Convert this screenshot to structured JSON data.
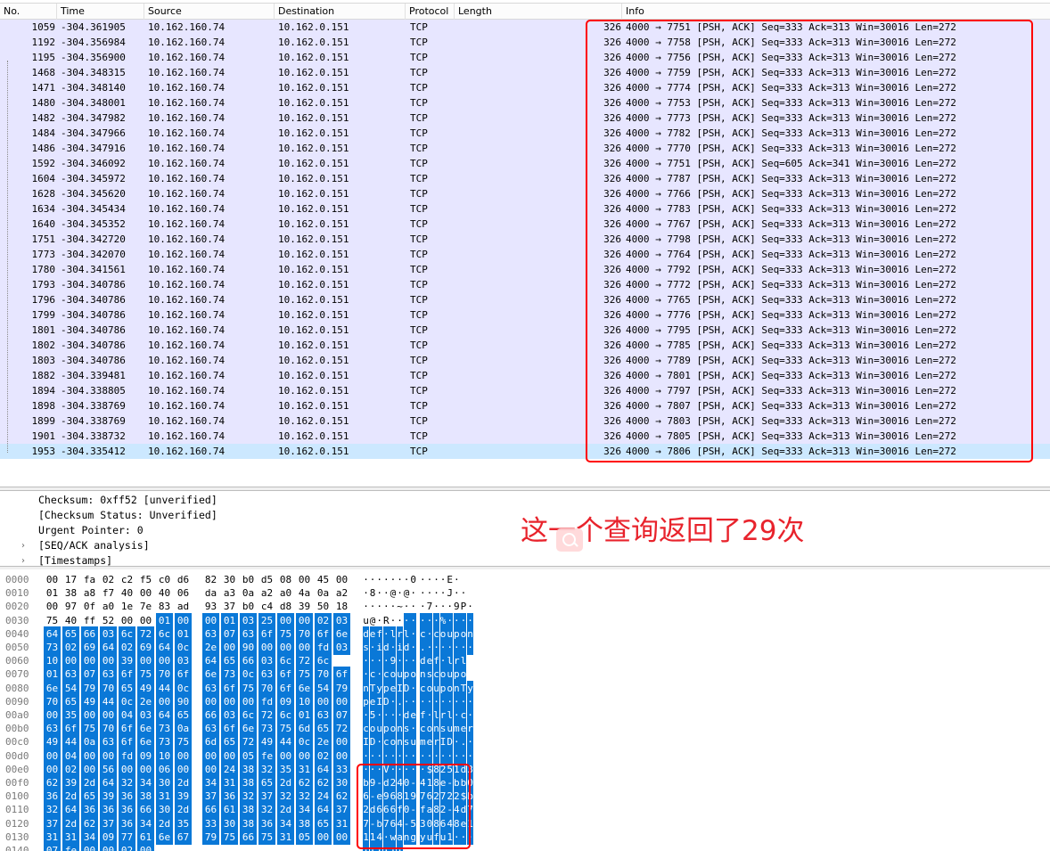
{
  "columns": {
    "no": "No.",
    "time": "Time",
    "source": "Source",
    "destination": "Destination",
    "protocol": "Protocol",
    "length": "Length",
    "info": "Info"
  },
  "packets": [
    {
      "no": "1059",
      "time": "-304.361905",
      "src": "10.162.160.74",
      "dst": "10.162.0.151",
      "proto": "TCP",
      "len": "326",
      "info": "4000 → 7751 [PSH, ACK] Seq=333 Ack=313 Win=30016 Len=272"
    },
    {
      "no": "1192",
      "time": "-304.356984",
      "src": "10.162.160.74",
      "dst": "10.162.0.151",
      "proto": "TCP",
      "len": "326",
      "info": "4000 → 7758 [PSH, ACK] Seq=333 Ack=313 Win=30016 Len=272"
    },
    {
      "no": "1195",
      "time": "-304.356900",
      "src": "10.162.160.74",
      "dst": "10.162.0.151",
      "proto": "TCP",
      "len": "326",
      "info": "4000 → 7756 [PSH, ACK] Seq=333 Ack=313 Win=30016 Len=272"
    },
    {
      "no": "1468",
      "time": "-304.348315",
      "src": "10.162.160.74",
      "dst": "10.162.0.151",
      "proto": "TCP",
      "len": "326",
      "info": "4000 → 7759 [PSH, ACK] Seq=333 Ack=313 Win=30016 Len=272"
    },
    {
      "no": "1471",
      "time": "-304.348140",
      "src": "10.162.160.74",
      "dst": "10.162.0.151",
      "proto": "TCP",
      "len": "326",
      "info": "4000 → 7774 [PSH, ACK] Seq=333 Ack=313 Win=30016 Len=272"
    },
    {
      "no": "1480",
      "time": "-304.348001",
      "src": "10.162.160.74",
      "dst": "10.162.0.151",
      "proto": "TCP",
      "len": "326",
      "info": "4000 → 7753 [PSH, ACK] Seq=333 Ack=313 Win=30016 Len=272"
    },
    {
      "no": "1482",
      "time": "-304.347982",
      "src": "10.162.160.74",
      "dst": "10.162.0.151",
      "proto": "TCP",
      "len": "326",
      "info": "4000 → 7773 [PSH, ACK] Seq=333 Ack=313 Win=30016 Len=272"
    },
    {
      "no": "1484",
      "time": "-304.347966",
      "src": "10.162.160.74",
      "dst": "10.162.0.151",
      "proto": "TCP",
      "len": "326",
      "info": "4000 → 7782 [PSH, ACK] Seq=333 Ack=313 Win=30016 Len=272"
    },
    {
      "no": "1486",
      "time": "-304.347916",
      "src": "10.162.160.74",
      "dst": "10.162.0.151",
      "proto": "TCP",
      "len": "326",
      "info": "4000 → 7770 [PSH, ACK] Seq=333 Ack=313 Win=30016 Len=272"
    },
    {
      "no": "1592",
      "time": "-304.346092",
      "src": "10.162.160.74",
      "dst": "10.162.0.151",
      "proto": "TCP",
      "len": "326",
      "info": "4000 → 7751 [PSH, ACK] Seq=605 Ack=341 Win=30016 Len=272"
    },
    {
      "no": "1604",
      "time": "-304.345972",
      "src": "10.162.160.74",
      "dst": "10.162.0.151",
      "proto": "TCP",
      "len": "326",
      "info": "4000 → 7787 [PSH, ACK] Seq=333 Ack=313 Win=30016 Len=272"
    },
    {
      "no": "1628",
      "time": "-304.345620",
      "src": "10.162.160.74",
      "dst": "10.162.0.151",
      "proto": "TCP",
      "len": "326",
      "info": "4000 → 7766 [PSH, ACK] Seq=333 Ack=313 Win=30016 Len=272"
    },
    {
      "no": "1634",
      "time": "-304.345434",
      "src": "10.162.160.74",
      "dst": "10.162.0.151",
      "proto": "TCP",
      "len": "326",
      "info": "4000 → 7783 [PSH, ACK] Seq=333 Ack=313 Win=30016 Len=272"
    },
    {
      "no": "1640",
      "time": "-304.345352",
      "src": "10.162.160.74",
      "dst": "10.162.0.151",
      "proto": "TCP",
      "len": "326",
      "info": "4000 → 7767 [PSH, ACK] Seq=333 Ack=313 Win=30016 Len=272"
    },
    {
      "no": "1751",
      "time": "-304.342720",
      "src": "10.162.160.74",
      "dst": "10.162.0.151",
      "proto": "TCP",
      "len": "326",
      "info": "4000 → 7798 [PSH, ACK] Seq=333 Ack=313 Win=30016 Len=272"
    },
    {
      "no": "1773",
      "time": "-304.342070",
      "src": "10.162.160.74",
      "dst": "10.162.0.151",
      "proto": "TCP",
      "len": "326",
      "info": "4000 → 7764 [PSH, ACK] Seq=333 Ack=313 Win=30016 Len=272"
    },
    {
      "no": "1780",
      "time": "-304.341561",
      "src": "10.162.160.74",
      "dst": "10.162.0.151",
      "proto": "TCP",
      "len": "326",
      "info": "4000 → 7792 [PSH, ACK] Seq=333 Ack=313 Win=30016 Len=272"
    },
    {
      "no": "1793",
      "time": "-304.340786",
      "src": "10.162.160.74",
      "dst": "10.162.0.151",
      "proto": "TCP",
      "len": "326",
      "info": "4000 → 7772 [PSH, ACK] Seq=333 Ack=313 Win=30016 Len=272"
    },
    {
      "no": "1796",
      "time": "-304.340786",
      "src": "10.162.160.74",
      "dst": "10.162.0.151",
      "proto": "TCP",
      "len": "326",
      "info": "4000 → 7765 [PSH, ACK] Seq=333 Ack=313 Win=30016 Len=272"
    },
    {
      "no": "1799",
      "time": "-304.340786",
      "src": "10.162.160.74",
      "dst": "10.162.0.151",
      "proto": "TCP",
      "len": "326",
      "info": "4000 → 7776 [PSH, ACK] Seq=333 Ack=313 Win=30016 Len=272"
    },
    {
      "no": "1801",
      "time": "-304.340786",
      "src": "10.162.160.74",
      "dst": "10.162.0.151",
      "proto": "TCP",
      "len": "326",
      "info": "4000 → 7795 [PSH, ACK] Seq=333 Ack=313 Win=30016 Len=272"
    },
    {
      "no": "1802",
      "time": "-304.340786",
      "src": "10.162.160.74",
      "dst": "10.162.0.151",
      "proto": "TCP",
      "len": "326",
      "info": "4000 → 7785 [PSH, ACK] Seq=333 Ack=313 Win=30016 Len=272"
    },
    {
      "no": "1803",
      "time": "-304.340786",
      "src": "10.162.160.74",
      "dst": "10.162.0.151",
      "proto": "TCP",
      "len": "326",
      "info": "4000 → 7789 [PSH, ACK] Seq=333 Ack=313 Win=30016 Len=272"
    },
    {
      "no": "1882",
      "time": "-304.339481",
      "src": "10.162.160.74",
      "dst": "10.162.0.151",
      "proto": "TCP",
      "len": "326",
      "info": "4000 → 7801 [PSH, ACK] Seq=333 Ack=313 Win=30016 Len=272"
    },
    {
      "no": "1894",
      "time": "-304.338805",
      "src": "10.162.160.74",
      "dst": "10.162.0.151",
      "proto": "TCP",
      "len": "326",
      "info": "4000 → 7797 [PSH, ACK] Seq=333 Ack=313 Win=30016 Len=272"
    },
    {
      "no": "1898",
      "time": "-304.338769",
      "src": "10.162.160.74",
      "dst": "10.162.0.151",
      "proto": "TCP",
      "len": "326",
      "info": "4000 → 7807 [PSH, ACK] Seq=333 Ack=313 Win=30016 Len=272"
    },
    {
      "no": "1899",
      "time": "-304.338769",
      "src": "10.162.160.74",
      "dst": "10.162.0.151",
      "proto": "TCP",
      "len": "326",
      "info": "4000 → 7803 [PSH, ACK] Seq=333 Ack=313 Win=30016 Len=272"
    },
    {
      "no": "1901",
      "time": "-304.338732",
      "src": "10.162.160.74",
      "dst": "10.162.0.151",
      "proto": "TCP",
      "len": "326",
      "info": "4000 → 7805 [PSH, ACK] Seq=333 Ack=313 Win=30016 Len=272"
    },
    {
      "no": "1953",
      "time": "-304.335412",
      "src": "10.162.160.74",
      "dst": "10.162.0.151",
      "proto": "TCP",
      "len": "326",
      "info": "4000 → 7806 [PSH, ACK] Seq=333 Ack=313 Win=30016 Len=272",
      "selected": true
    }
  ],
  "details": {
    "checksum": "Checksum: 0xff52 [unverified]",
    "checksum_status": "[Checksum Status: Unverified]",
    "urgent_pointer": "Urgent Pointer: 0",
    "seq_ack": "[SEQ/ACK analysis]",
    "timestamps": "[Timestamps]",
    "expand_arrow": "›"
  },
  "annotation": {
    "text": "这一个查询返回了29次",
    "color": "#e8232c",
    "icon": "search-icon"
  },
  "highlight_color": "#0a78d7",
  "hex_rows": [
    {
      "offset": "0000",
      "bytes": [
        "00",
        "17",
        "fa",
        "02",
        "c2",
        "f5",
        "c0",
        "d6",
        "82",
        "30",
        "b0",
        "d5",
        "08",
        "00",
        "45",
        "00"
      ],
      "ascii": "·······0····E·",
      "hl_from": 99
    },
    {
      "offset": "0010",
      "bytes": [
        "01",
        "38",
        "a8",
        "f7",
        "40",
        "00",
        "40",
        "06",
        "da",
        "a3",
        "0a",
        "a2",
        "a0",
        "4a",
        "0a",
        "a2"
      ],
      "ascii": "·8··@·@·····J··",
      "hl_from": 99
    },
    {
      "offset": "0020",
      "bytes": [
        "00",
        "97",
        "0f",
        "a0",
        "1e",
        "7e",
        "83",
        "ad",
        "93",
        "37",
        "b0",
        "c4",
        "d8",
        "39",
        "50",
        "18"
      ],
      "ascii": "·····~···7···9P·",
      "hl_from": 99
    },
    {
      "offset": "0030",
      "bytes": [
        "75",
        "40",
        "ff",
        "52",
        "00",
        "00",
        "01",
        "00",
        "00",
        "01",
        "03",
        "25",
        "00",
        "00",
        "02",
        "03"
      ],
      "ascii": "u@·R·······%····",
      "hl_from": 6
    },
    {
      "offset": "0040",
      "bytes": [
        "64",
        "65",
        "66",
        "03",
        "6c",
        "72",
        "6c",
        "01",
        "63",
        "07",
        "63",
        "6f",
        "75",
        "70",
        "6f",
        "6e"
      ],
      "ascii": "def·lrl·c·coupon",
      "hl_from": 0
    },
    {
      "offset": "0050",
      "bytes": [
        "73",
        "02",
        "69",
        "64",
        "02",
        "69",
        "64",
        "0c",
        "2e",
        "00",
        "90",
        "00",
        "00",
        "00",
        "fd",
        "03"
      ],
      "ascii": "s·id·id·.·······",
      "hl_from": 0
    },
    {
      "offset": "0060",
      "bytes": [
        "10",
        "00",
        "00",
        "00",
        "39",
        "00",
        "00",
        "03",
        "64",
        "65",
        "66",
        "03",
        "6c",
        "72",
        "6c"
      ],
      "ascii": "····9···def·lrl",
      "hl_from": 0
    },
    {
      "offset": "0070",
      "bytes": [
        "01",
        "63",
        "07",
        "63",
        "6f",
        "75",
        "70",
        "6f",
        "6e",
        "73",
        "0c",
        "63",
        "6f",
        "75",
        "70",
        "6f"
      ],
      "ascii": "·c·couponscoupo",
      "hl_from": 0
    },
    {
      "offset": "0080",
      "bytes": [
        "6e",
        "54",
        "79",
        "70",
        "65",
        "49",
        "44",
        "0c",
        "63",
        "6f",
        "75",
        "70",
        "6f",
        "6e",
        "54",
        "79"
      ],
      "ascii": "nTypeID·couponTy",
      "hl_from": 0
    },
    {
      "offset": "0090",
      "bytes": [
        "70",
        "65",
        "49",
        "44",
        "0c",
        "2e",
        "00",
        "90",
        "00",
        "00",
        "00",
        "fd",
        "09",
        "10",
        "00",
        "00"
      ],
      "ascii": "peID·.··········",
      "hl_from": 0
    },
    {
      "offset": "00a0",
      "bytes": [
        "00",
        "35",
        "00",
        "00",
        "04",
        "03",
        "64",
        "65",
        "66",
        "03",
        "6c",
        "72",
        "6c",
        "01",
        "63",
        "07"
      ],
      "ascii": "·5····def·lrl·c·",
      "hl_from": 0
    },
    {
      "offset": "00b0",
      "bytes": [
        "63",
        "6f",
        "75",
        "70",
        "6f",
        "6e",
        "73",
        "0a",
        "63",
        "6f",
        "6e",
        "73",
        "75",
        "6d",
        "65",
        "72"
      ],
      "ascii": "coupons·consumer",
      "hl_from": 0
    },
    {
      "offset": "00c0",
      "bytes": [
        "49",
        "44",
        "0a",
        "63",
        "6f",
        "6e",
        "73",
        "75",
        "6d",
        "65",
        "72",
        "49",
        "44",
        "0c",
        "2e",
        "00"
      ],
      "ascii": "ID·consumerID·.·",
      "hl_from": 0
    },
    {
      "offset": "00d0",
      "bytes": [
        "00",
        "04",
        "00",
        "00",
        "fd",
        "09",
        "10",
        "00",
        "00",
        "00",
        "05",
        "fe",
        "00",
        "00",
        "02",
        "00"
      ],
      "ascii": "················",
      "hl_from": 0
    },
    {
      "offset": "00e0",
      "bytes": [
        "00",
        "02",
        "00",
        "56",
        "00",
        "00",
        "06",
        "00",
        "00",
        "24",
        "38",
        "32",
        "35",
        "31",
        "64",
        "33"
      ],
      "ascii": "···V·····$8251d3",
      "hl_from": 0
    },
    {
      "offset": "00f0",
      "bytes": [
        "62",
        "39",
        "2d",
        "64",
        "32",
        "34",
        "30",
        "2d",
        "34",
        "31",
        "38",
        "65",
        "2d",
        "62",
        "62",
        "30"
      ],
      "ascii": "b9-d240-418e-bb0",
      "hl_from": 0
    },
    {
      "offset": "0100",
      "bytes": [
        "36",
        "2d",
        "65",
        "39",
        "36",
        "38",
        "31",
        "39",
        "37",
        "36",
        "32",
        "37",
        "32",
        "32",
        "24",
        "62"
      ],
      "ascii": "6-e96819762722$b",
      "hl_from": 0
    },
    {
      "offset": "0110",
      "bytes": [
        "32",
        "64",
        "36",
        "36",
        "36",
        "66",
        "30",
        "2d",
        "66",
        "61",
        "38",
        "32",
        "2d",
        "34",
        "64",
        "37"
      ],
      "ascii": "2d666f0-fa82-4d7",
      "hl_from": 0
    },
    {
      "offset": "0120",
      "bytes": [
        "37",
        "2d",
        "62",
        "37",
        "36",
        "34",
        "2d",
        "35",
        "33",
        "30",
        "38",
        "36",
        "34",
        "38",
        "65",
        "31"
      ],
      "ascii": "7-b764-5308648e1",
      "hl_from": 0
    },
    {
      "offset": "0130",
      "bytes": [
        "31",
        "31",
        "34",
        "09",
        "77",
        "61",
        "6e",
        "67",
        "79",
        "75",
        "66",
        "75",
        "31",
        "05",
        "00",
        "00"
      ],
      "ascii": "114·wangyufu1···",
      "hl_from": 0
    },
    {
      "offset": "0140",
      "bytes": [
        "07",
        "fe",
        "00",
        "00",
        "02",
        "00"
      ],
      "ascii": "······",
      "hl_from": 0
    }
  ]
}
